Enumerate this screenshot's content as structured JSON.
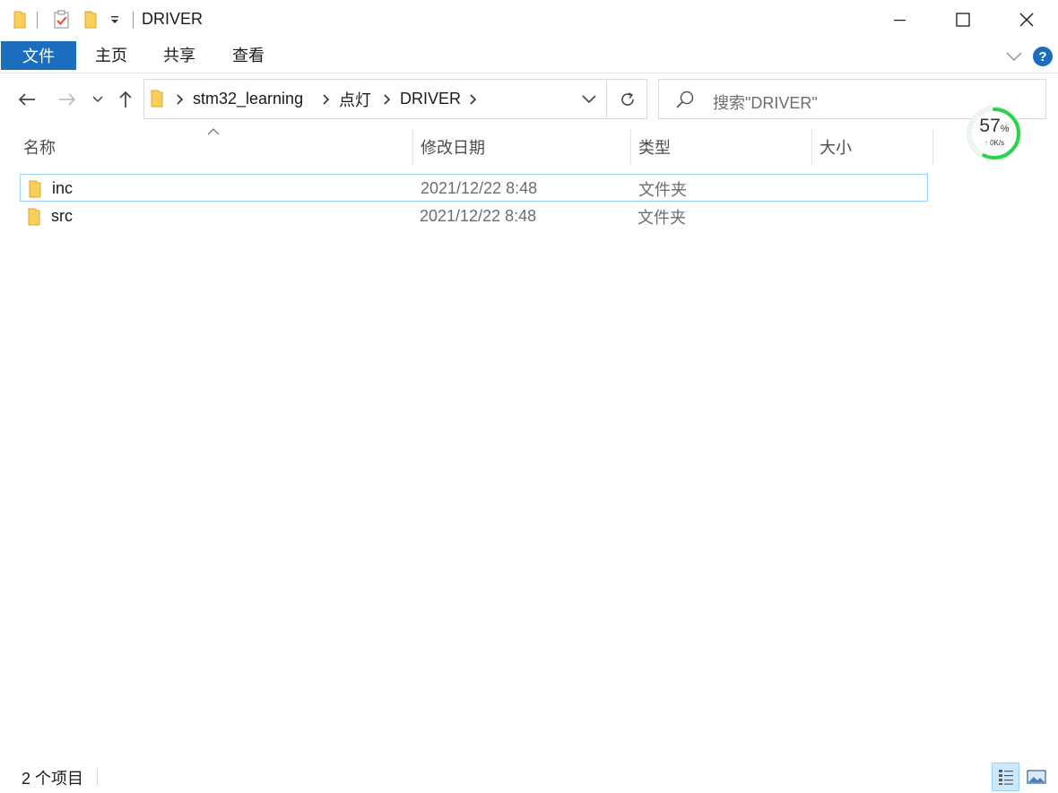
{
  "window": {
    "title": "DRIVER"
  },
  "ribbon": {
    "tabs": [
      {
        "label": "文件"
      },
      {
        "label": "主页"
      },
      {
        "label": "共享"
      },
      {
        "label": "查看"
      }
    ],
    "help_label": "?"
  },
  "address_bar": {
    "breadcrumbs": [
      {
        "label": "stm32_learning"
      },
      {
        "label": "点灯"
      },
      {
        "label": "DRIVER"
      }
    ]
  },
  "search": {
    "placeholder": "搜索\"DRIVER\""
  },
  "columns": [
    {
      "label": "名称"
    },
    {
      "label": "修改日期"
    },
    {
      "label": "类型"
    },
    {
      "label": "大小"
    }
  ],
  "files": [
    {
      "name": "inc",
      "modified": "2021/12/22 8:48",
      "type": "文件夹",
      "size": "",
      "selected": true,
      "icon": "folder-icon"
    },
    {
      "name": "src",
      "modified": "2021/12/22 8:48",
      "type": "文件夹",
      "size": "",
      "selected": false,
      "icon": "folder-icon"
    }
  ],
  "performance_widget": {
    "percent": "57",
    "percent_unit": "%",
    "speed": "0K/s",
    "ring_fraction": 0.57,
    "ring_color": "#2bd24c"
  },
  "status_bar": {
    "item_count": "2 个项目"
  },
  "colors": {
    "accent": "#1a6ebd",
    "selection_border": "#99d1ff",
    "folder": "#f7cf5a"
  }
}
